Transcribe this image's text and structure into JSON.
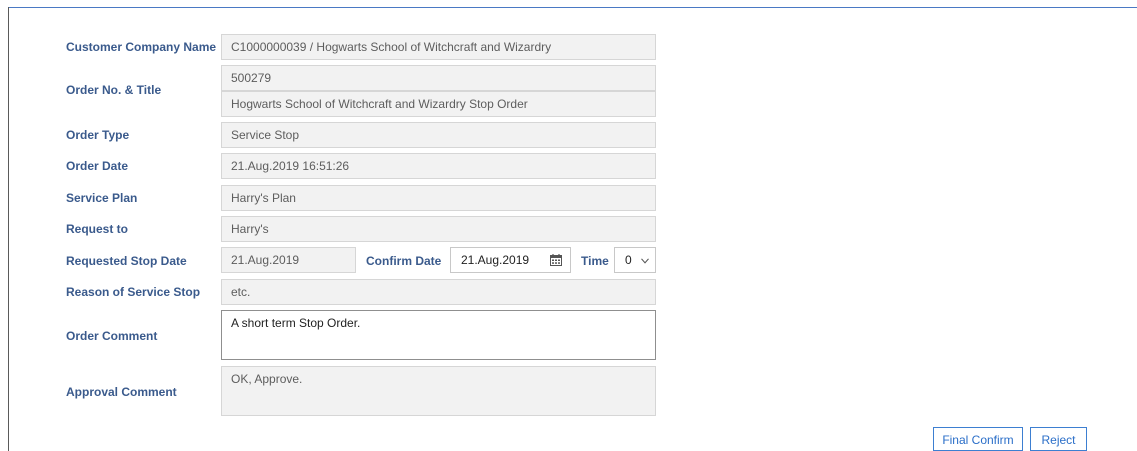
{
  "form": {
    "customer_company": {
      "label": "Customer Company Name",
      "value": "C1000000039 / Hogwarts School of Witchcraft and Wizardry"
    },
    "order_no_title": {
      "label": "Order No. & Title",
      "order_no": "500279",
      "title": "Hogwarts School of Witchcraft and Wizardry Stop Order"
    },
    "order_type": {
      "label": "Order Type",
      "value": "Service Stop"
    },
    "order_date": {
      "label": "Order Date",
      "value": "21.Aug.2019 16:51:26"
    },
    "service_plan": {
      "label": "Service Plan",
      "value": "Harry's Plan"
    },
    "request_to": {
      "label": "Request to",
      "value": "Harry's"
    },
    "requested_stop_date": {
      "label": "Requested Stop Date",
      "value": "21.Aug.2019"
    },
    "confirm_date": {
      "label": "Confirm Date",
      "value": "21.Aug.2019",
      "icon": "calendar-icon"
    },
    "time": {
      "label": "Time",
      "value": "0",
      "icon": "chevron-down-icon"
    },
    "reason": {
      "label": "Reason of Service Stop",
      "value": "etc."
    },
    "order_comment": {
      "label": "Order Comment",
      "value": "A short term Stop Order."
    },
    "approval_comment": {
      "label": "Approval Comment",
      "value": "OK, Approve."
    }
  },
  "actions": {
    "final_confirm": "Final Confirm",
    "reject": "Reject"
  },
  "colors": {
    "label": "#3a5a8c",
    "accent": "#2a6ec8",
    "readonly_bg": "#f2f2f2",
    "frame": "#4a79c4"
  }
}
